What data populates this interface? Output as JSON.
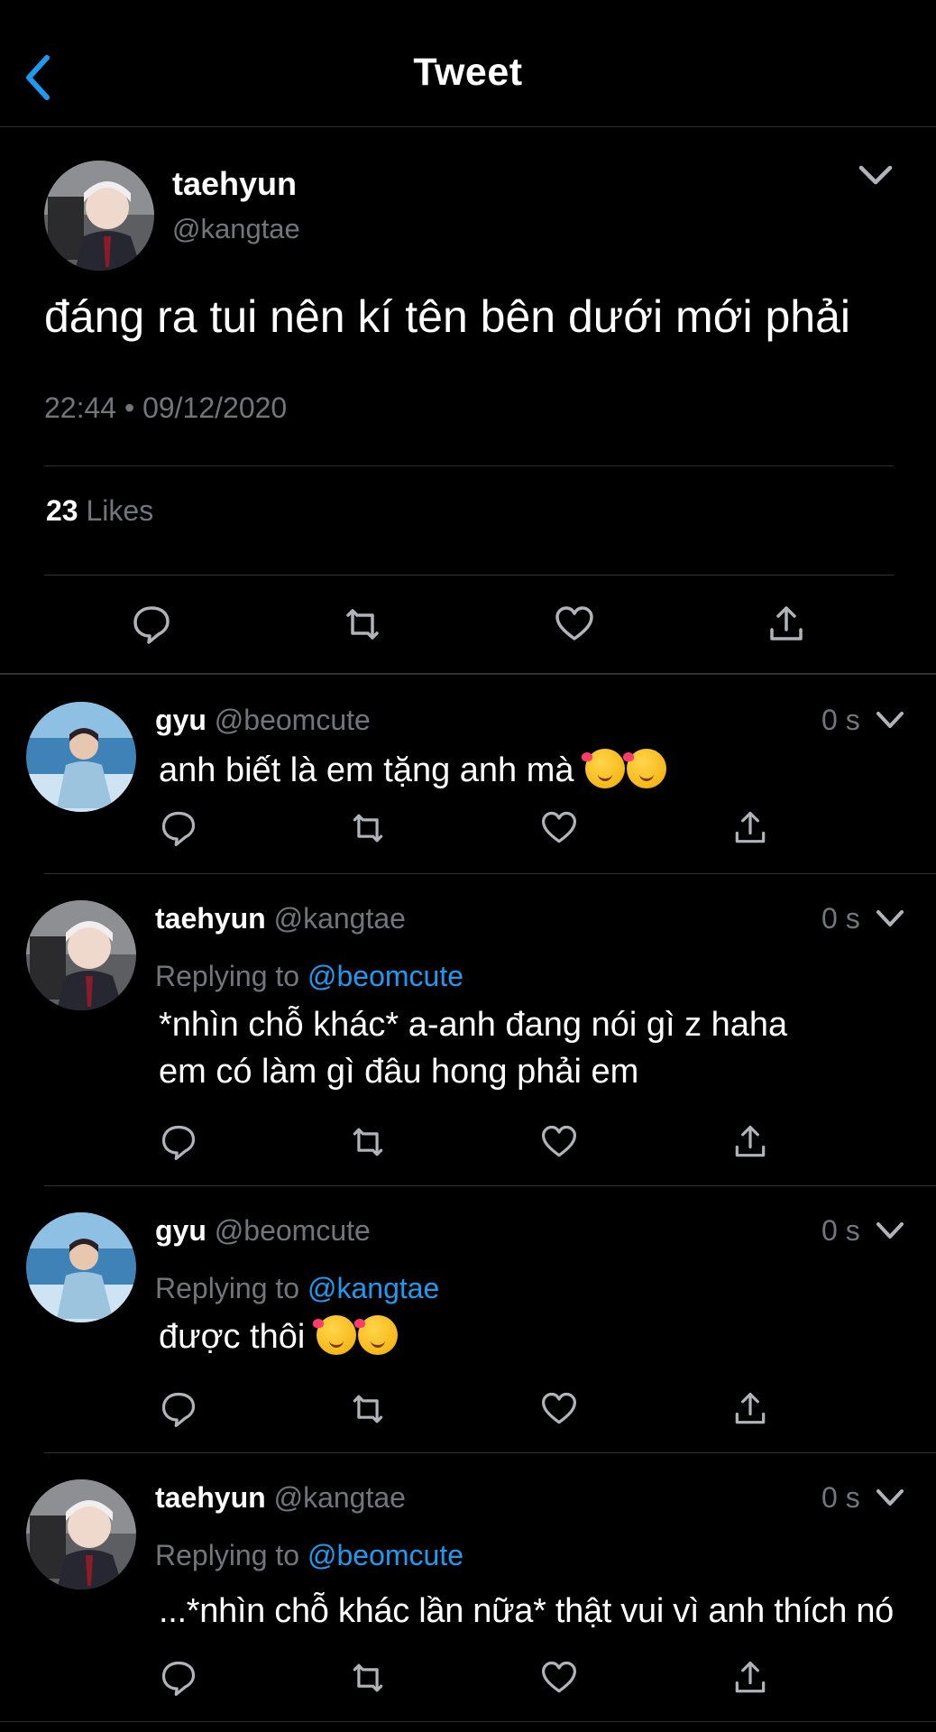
{
  "header": {
    "title": "Tweet"
  },
  "main_tweet": {
    "name": "taehyun",
    "handle": "@kangtae",
    "text": "đáng ra tui nên kí tên bên dưới mới phải",
    "timestamp": "22:44 • 09/12/2020",
    "likes_count": "23",
    "likes_label": "Likes"
  },
  "replies": [
    {
      "name": "gyu",
      "handle": "@beomcute",
      "time": "0 s",
      "replying_label": "",
      "replying_to": "",
      "lines": [
        "anh biết là em tặng anh mà"
      ],
      "emoji": "smiling-face-with-hearts x2"
    },
    {
      "name": "taehyun",
      "handle": "@kangtae",
      "time": "0 s",
      "replying_label": "Replying to",
      "replying_to": "@beomcute",
      "lines": [
        "*nhìn chỗ khác* a-anh đang nói gì z haha",
        "em có làm gì đâu hong phải em"
      ]
    },
    {
      "name": "gyu",
      "handle": "@beomcute",
      "time": "0 s",
      "replying_label": "Replying to",
      "replying_to": "@kangtae",
      "lines": [
        "được thôi"
      ],
      "emoji": "smiling-face-with-hearts x2"
    },
    {
      "name": "taehyun",
      "handle": "@kangtae",
      "time": "0 s",
      "replying_label": "Replying to",
      "replying_to": "@beomcute",
      "lines": [
        "...*nhìn chỗ khác lần nữa* thật vui vì anh thích nó"
      ]
    }
  ],
  "icons": [
    "back-chevron-icon",
    "chevron-down-icon",
    "reply-icon",
    "retweet-icon",
    "like-icon",
    "share-icon"
  ],
  "colors": {
    "background": "#000000",
    "text": "#ffffff",
    "secondary": "#71767b",
    "accent": "#1d9bf0",
    "divider": "#2f3336"
  }
}
